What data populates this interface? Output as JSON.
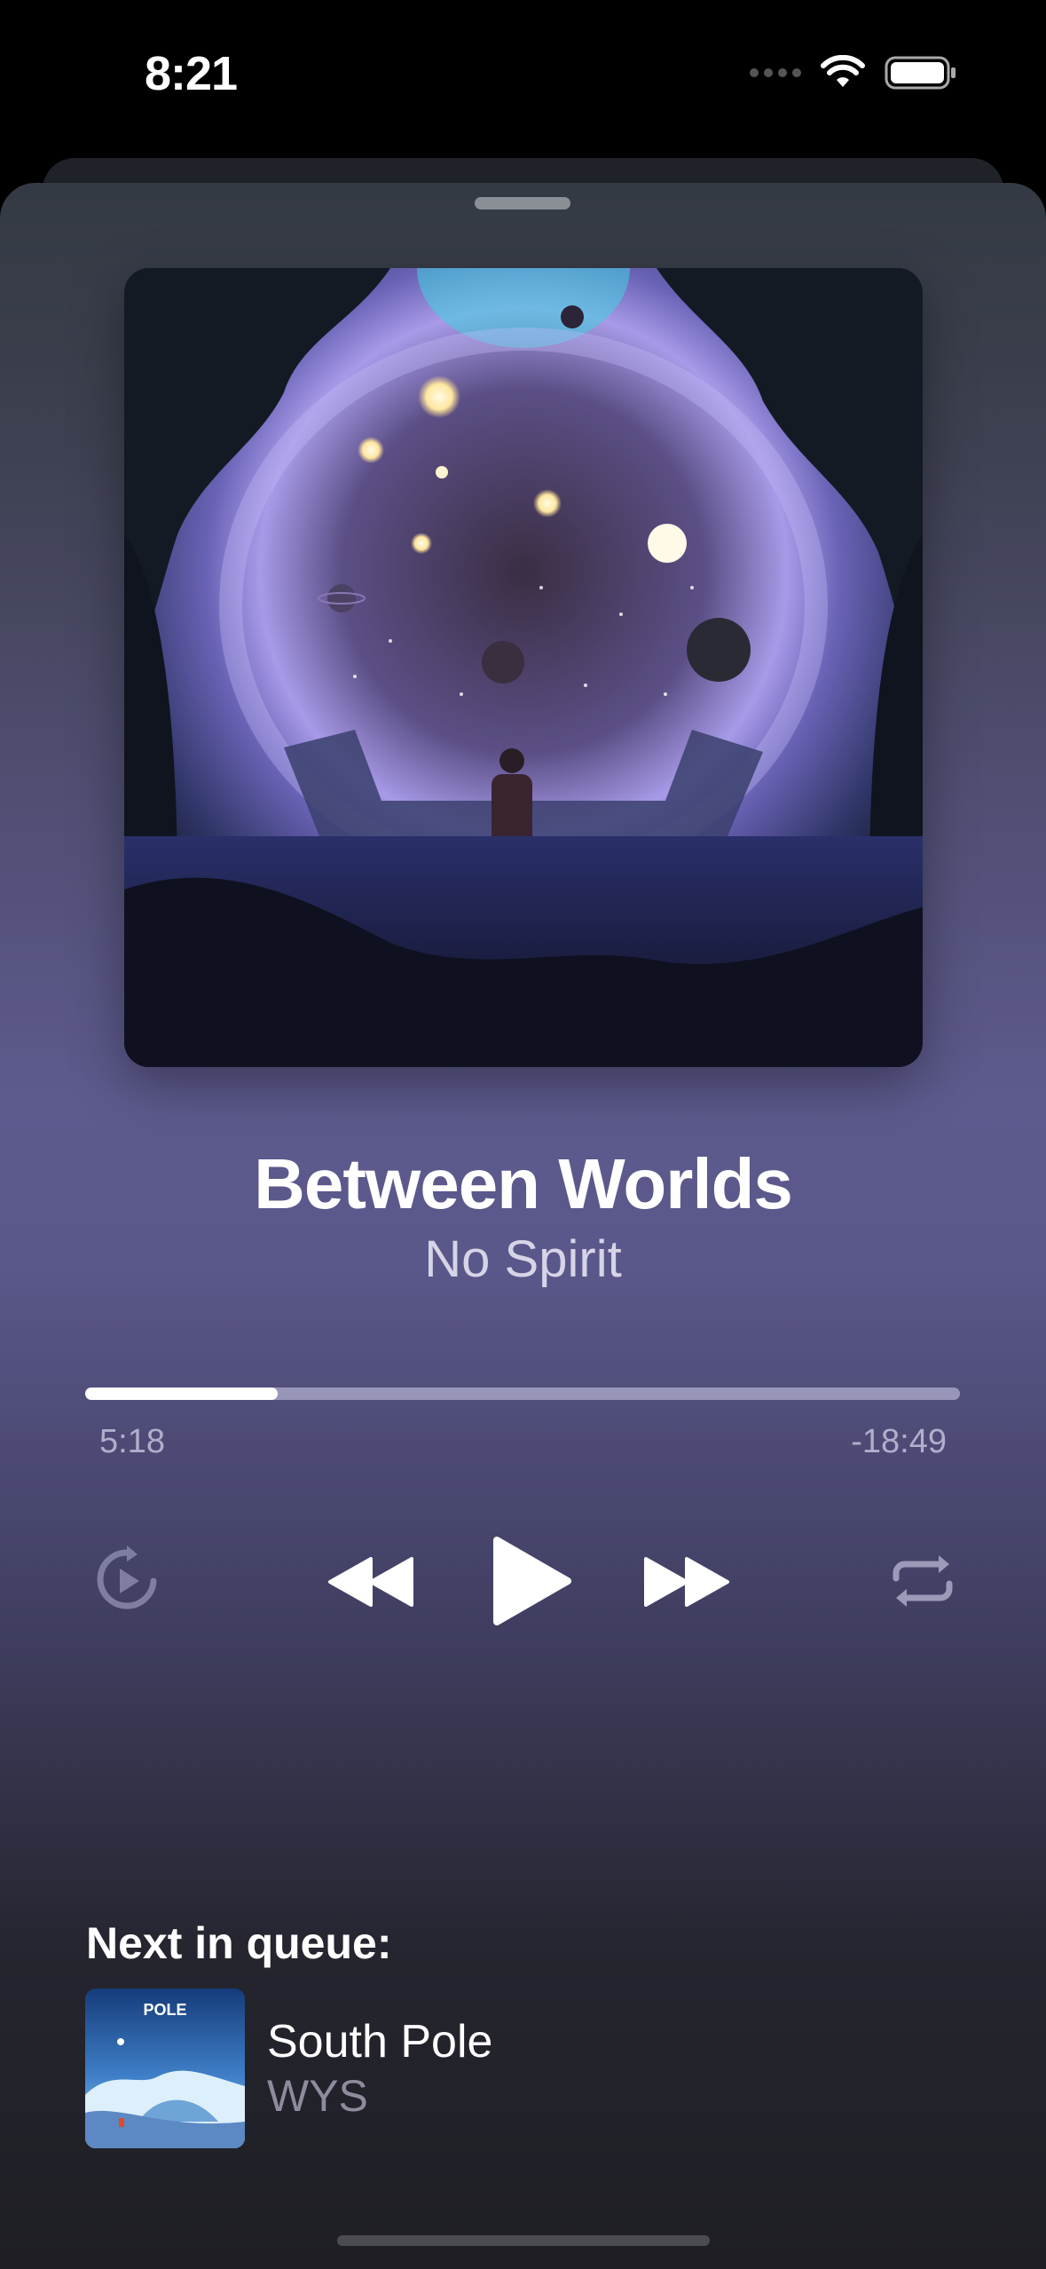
{
  "status_bar": {
    "time": "8:21"
  },
  "now_playing": {
    "title": "Between Worlds",
    "artist": "No Spirit",
    "elapsed": "5:18",
    "remaining": "-18:49",
    "progress_fraction": 0.22
  },
  "controls": {
    "autoplay_icon": "autoplay-icon",
    "rewind_icon": "rewind-icon",
    "play_icon": "play-icon",
    "fast_forward_icon": "fast-forward-icon",
    "repeat_icon": "repeat-icon"
  },
  "queue": {
    "label": "Next in queue:",
    "items": [
      {
        "title": "South Pole",
        "artist": "WYS",
        "cover_text": "POLE"
      }
    ]
  },
  "colors": {
    "accent": "#ffffff",
    "track": "#9896b8",
    "secondary_text": "#8e8c9c"
  }
}
